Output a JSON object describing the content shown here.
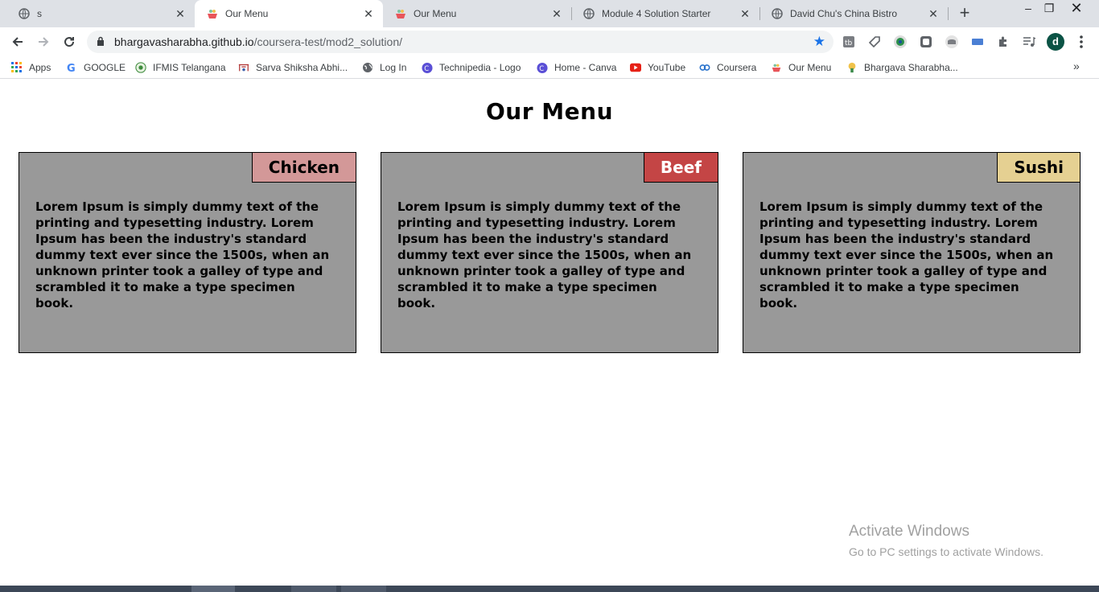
{
  "browser": {
    "tabs": [
      {
        "title": "s",
        "icon": "globe-icon",
        "active": false
      },
      {
        "title": "Our Menu",
        "icon": "our-menu-favicon",
        "active": true
      },
      {
        "title": "Our Menu",
        "icon": "our-menu-favicon",
        "active": false
      },
      {
        "title": "Module 4 Solution Starter",
        "icon": "globe-icon",
        "active": false
      },
      {
        "title": "David Chu's China Bistro",
        "icon": "globe-icon",
        "active": false
      }
    ],
    "url_host": "bhargavasharabha.github.io",
    "url_path": "/coursera-test/mod2_solution/",
    "profile_initial": "d",
    "bookmarks": [
      {
        "label": "Apps",
        "icon": "apps-grid-icon"
      },
      {
        "label": "GOOGLE",
        "icon": "google-icon"
      },
      {
        "label": "IFMIS Telangana",
        "icon": "ifmis-icon"
      },
      {
        "label": "Sarva Shiksha Abhi...",
        "icon": "sarva-shiksha-icon"
      },
      {
        "label": "Log In",
        "icon": "globe-icon"
      },
      {
        "label": "Technipedia - Logo",
        "icon": "canva-icon"
      },
      {
        "label": "Home - Canva",
        "icon": "canva-icon"
      },
      {
        "label": "YouTube",
        "icon": "youtube-icon"
      },
      {
        "label": "Coursera",
        "icon": "coursera-icon"
      },
      {
        "label": "Our Menu",
        "icon": "our-menu-favicon"
      },
      {
        "label": "Bhargava Sharabha...",
        "icon": "bhargava-icon"
      }
    ]
  },
  "page": {
    "title": "Our Menu",
    "cards": [
      {
        "label": "Chicken",
        "label_bg": "#d39898",
        "label_color": "#000000",
        "text": "Lorem Ipsum is simply dummy text of the printing and typesetting industry. Lorem Ipsum has been the industry's standard dummy text ever since the 1500s, when an unknown printer took a galley of type and scrambled it to make a type specimen book."
      },
      {
        "label": "Beef",
        "label_bg": "#c44545",
        "label_color": "#ffffff",
        "text": "Lorem Ipsum is simply dummy text of the printing and typesetting industry. Lorem Ipsum has been the industry's standard dummy text ever since the 1500s, when an unknown printer took a galley of type and scrambled it to make a type specimen book."
      },
      {
        "label": "Sushi",
        "label_bg": "#e5d092",
        "label_color": "#000000",
        "text": "Lorem Ipsum is simply dummy text of the printing and typesetting industry. Lorem Ipsum has been the industry's standard dummy text ever since the 1500s, when an unknown printer took a galley of type and scrambled it to make a type specimen book."
      }
    ],
    "card_bg": "#999999"
  },
  "watermark": {
    "line1": "Activate Windows",
    "line2": "Go to PC settings to activate Windows."
  }
}
